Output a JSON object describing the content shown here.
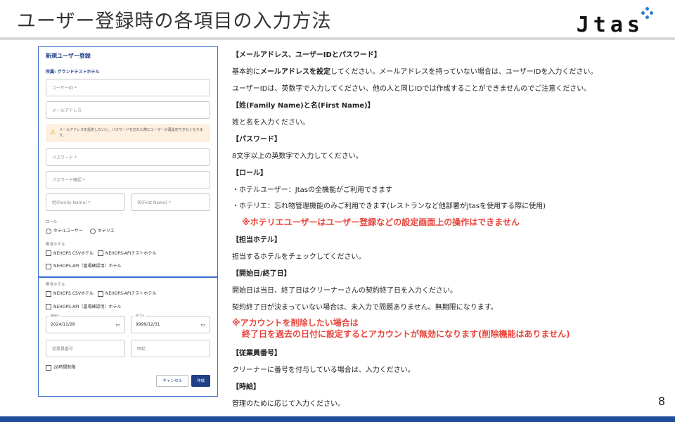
{
  "slide": {
    "title": "ユーザー登録時の各項目の入力方法",
    "logo_text": "Jtas",
    "page_number": "8"
  },
  "form": {
    "title": "新規ユーザー登録",
    "hotel_label": "所属: グランドテストホテル",
    "user_id_placeholder": "ユーザーID *",
    "email_placeholder": "メールアドレス",
    "warning_text": "メールアドレスを設定しないと、パスワードを忘れた際にユーザーが再設定できなくなります。",
    "password_placeholder": "パスワード *",
    "password_confirm_placeholder": "パスワード確認 *",
    "family_name_placeholder": "姓(Family Name) *",
    "first_name_placeholder": "名(First Name) *",
    "role_label": "ロール",
    "role_options": [
      "ホテルユーザー",
      "ホテリエ"
    ],
    "hotel_section_label": "担当ホテル",
    "hotels_row1": [
      "NEHOPS CSVホテル",
      "NEHOPS-APIテストホテル"
    ],
    "hotel_row2": "NEHOPS-API（富場確認用）ホテル",
    "start_date_caption": "開始日",
    "start_date_value": "2024/11/28",
    "end_date_caption": "終了日",
    "end_date_value": "9999/12/31",
    "employee_no_placeholder": "従業員番号",
    "hourly_wage_placeholder": "時給",
    "hours28_label": "28時間制限",
    "cancel_label": "キャンセル",
    "create_label": "作成"
  },
  "explanation": {
    "h_email": "【メールアドレス、ユーザーIDとパスワード】",
    "email_pre": "基本的に",
    "email_bold": "メールアドレスを設定",
    "email_post": "してください。メールアドレスを持っていない場合は、ユーザーIDを入力ください。",
    "userid_note": "ユーザーIDは、英数字で入力してください、他の人と同じIDでは作成することができませんのでご注意ください。",
    "h_name": "【姓(Family Name)と名(First Name)】",
    "name_note": "姓と名を入力ください。",
    "h_password": "【パスワード】",
    "password_note": "8文字以上の英数字で入力してください。",
    "h_role": "【ロール】",
    "role_hotel_user": "・ホテルユーザー：Jtasの全機能がご利用できます",
    "role_hotelier": "・ホテリエ：忘れ物管理機能のみご利用できます(レストランなど他部署がJtasを使用する際に使用)",
    "role_warning": "※ホテリエユーザーはユーザー登録などの設定画面上の操作はできません",
    "h_hotel": "【担当ホテル】",
    "hotel_note": "担当するホテルをチェックしてください。",
    "h_dates": "【開始日/終了日】",
    "dates_note1": "開始日は当日、終了日はクリーナーさんの契約終了日を入力ください。",
    "dates_note2": "契約終了日が決まっていない場合は、未入力で問題ありません。無期限になります。",
    "delete_warning1": "※アカウントを削除したい場合は",
    "delete_warning2": "終了日を過去の日付に設定するとアカウントが無効になります(削除機能はありません)",
    "h_employee": "【従業員番号】",
    "employee_note": "クリーナーに番号を付与している場合は、入力ください。",
    "h_wage": "【時給】",
    "wage_note": "管理のために応じて入力ください。"
  },
  "colors": {
    "accent_blue": "#1e4e9c",
    "warning_red": "#e8453c",
    "logo_mark": "#2b7cd3"
  }
}
